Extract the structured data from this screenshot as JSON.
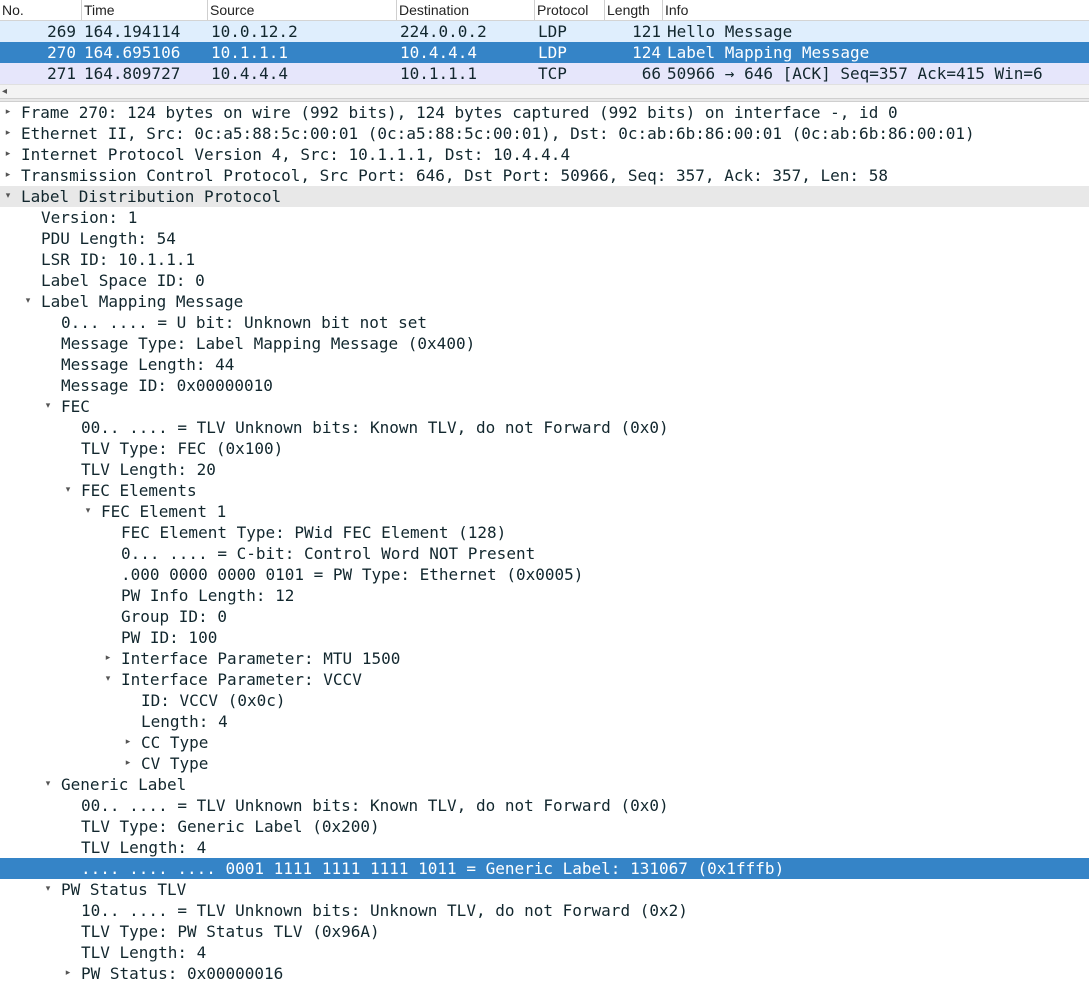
{
  "packet_list": {
    "columns": [
      "No.",
      "Time",
      "Source",
      "Destination",
      "Protocol",
      "Length",
      "Info"
    ],
    "rows": [
      {
        "no": "269",
        "time": "164.194114",
        "source": "10.0.12.2",
        "destination": "224.0.0.2",
        "protocol": "LDP",
        "length": "121",
        "info": "Hello Message"
      },
      {
        "no": "270",
        "time": "164.695106",
        "source": "10.1.1.1",
        "destination": "10.4.4.4",
        "protocol": "LDP",
        "length": "124",
        "info": "Label Mapping Message"
      },
      {
        "no": "271",
        "time": "164.809727",
        "source": "10.4.4.4",
        "destination": "10.1.1.1",
        "protocol": "TCP",
        "length": "66",
        "info": "50966 → 646 [ACK] Seq=357 Ack=415 Win=6"
      }
    ],
    "scroll_left_arrow": "◂"
  },
  "packet_details": {
    "lines": [
      {
        "text": "Frame 270: 124 bytes on wire (992 bits), 124 bytes captured (992 bits) on interface -, id 0"
      },
      {
        "text": "Ethernet II, Src: 0c:a5:88:5c:00:01 (0c:a5:88:5c:00:01), Dst: 0c:ab:6b:86:00:01 (0c:ab:6b:86:00:01)"
      },
      {
        "text": "Internet Protocol Version 4, Src: 10.1.1.1, Dst: 10.4.4.4"
      },
      {
        "text": "Transmission Control Protocol, Src Port: 646, Dst Port: 50966, Seq: 357, Ack: 357, Len: 58"
      },
      {
        "text": "Label Distribution Protocol"
      },
      {
        "text": "Version: 1"
      },
      {
        "text": "PDU Length: 54"
      },
      {
        "text": "LSR ID: 10.1.1.1"
      },
      {
        "text": "Label Space ID: 0"
      },
      {
        "text": "Label Mapping Message"
      },
      {
        "text": "0... .... = U bit: Unknown bit not set"
      },
      {
        "text": "Message Type: Label Mapping Message (0x400)"
      },
      {
        "text": "Message Length: 44"
      },
      {
        "text": "Message ID: 0x00000010"
      },
      {
        "text": "FEC"
      },
      {
        "text": "00.. .... = TLV Unknown bits: Known TLV, do not Forward (0x0)"
      },
      {
        "text": "TLV Type: FEC (0x100)"
      },
      {
        "text": "TLV Length: 20"
      },
      {
        "text": "FEC Elements"
      },
      {
        "text": "FEC Element 1"
      },
      {
        "text": "FEC Element Type: PWid FEC Element (128)"
      },
      {
        "text": "0... .... = C-bit: Control Word NOT Present"
      },
      {
        "text": ".000 0000 0000 0101 = PW Type: Ethernet (0x0005)"
      },
      {
        "text": "PW Info Length: 12"
      },
      {
        "text": "Group ID: 0"
      },
      {
        "text": "PW ID: 100"
      },
      {
        "text": "Interface Parameter: MTU 1500"
      },
      {
        "text": "Interface Parameter: VCCV"
      },
      {
        "text": "ID: VCCV (0x0c)"
      },
      {
        "text": "Length: 4"
      },
      {
        "text": "CC Type"
      },
      {
        "text": "CV Type"
      },
      {
        "text": "Generic Label"
      },
      {
        "text": "00.. .... = TLV Unknown bits: Known TLV, do not Forward (0x0)"
      },
      {
        "text": "TLV Type: Generic Label (0x200)"
      },
      {
        "text": "TLV Length: 4"
      },
      {
        "text": ".... .... .... 0001 1111 1111 1111 1011 = Generic Label: 131067 (0x1fffb)"
      },
      {
        "text": "PW Status TLV"
      },
      {
        "text": "10.. .... = TLV Unknown bits: Unknown TLV, do not Forward (0x2)"
      },
      {
        "text": "TLV Type: PW Status TLV (0x96A)"
      },
      {
        "text": "TLV Length: 4"
      },
      {
        "text": "PW Status: 0x00000016"
      }
    ]
  },
  "icons": {
    "collapsed": "▸",
    "expanded": "▾"
  },
  "colors": {
    "selected_row": "#3584c7",
    "ldp_row": "#dfeefd",
    "tcp_row": "#e6e6fb",
    "section_highlight": "#e8e8e8"
  }
}
